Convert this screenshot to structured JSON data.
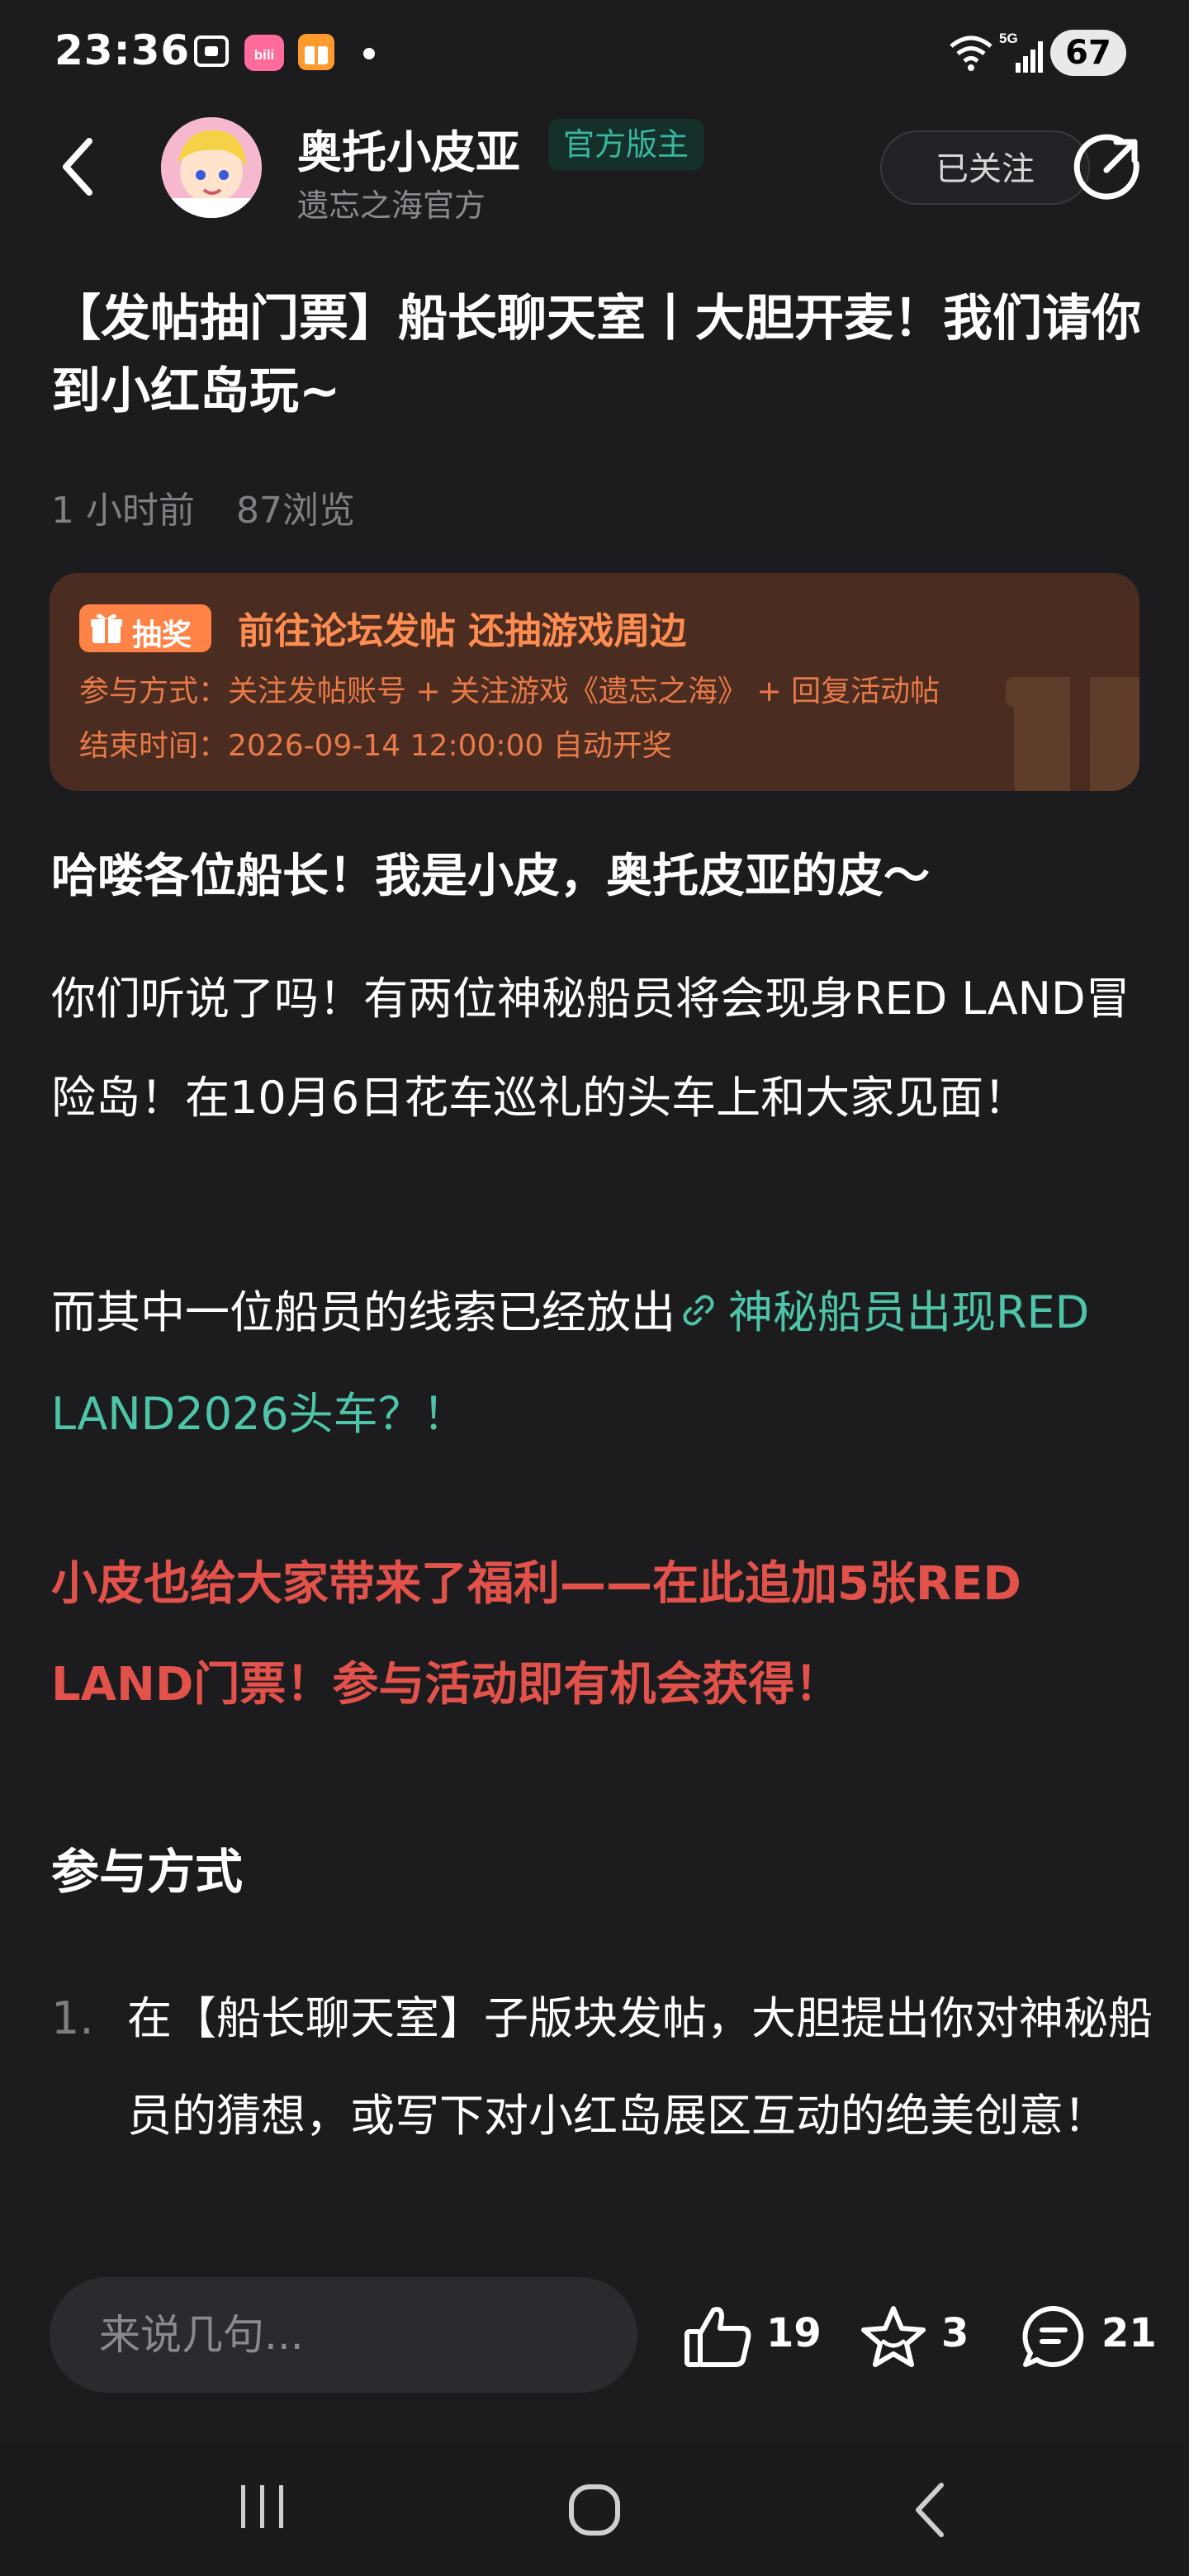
{
  "status_bar": {
    "time": "23:36",
    "network": "5G",
    "battery": "67"
  },
  "header": {
    "author": "奥托小皮亚",
    "badge": "官方版主",
    "subname": "遗忘之海官方",
    "follow_label": "已关注"
  },
  "post": {
    "title": "【发帖抽门票】船长聊天室丨大胆开麦！我们请你到小红岛玩~",
    "time_ago": "1 小时前",
    "views": "87浏览"
  },
  "lottery": {
    "tag": "抽奖",
    "headline": "前往论坛发帖 还抽游戏周边",
    "method": "参与方式：关注发帖账号 + 关注游戏《遗忘之海》 + 回复活动帖",
    "end_time": "结束时间：2026-09-14 12:00:00 自动开奖"
  },
  "content": {
    "greeting": "哈喽各位船长！我是小皮，奥托皮亚的皮～",
    "para1": "你们听说了吗！有两位神秘船员将会现身RED LAND冒险岛！在10月6日花车巡礼的头车上和大家见面！",
    "para2_prefix": "而其中一位船员的线索已经放出",
    "para2_link": "神秘船员出现RED LAND2026头车？！",
    "highlight": "小皮也给大家带来了福利——在此追加5张RED LAND门票！参与活动即有机会获得！",
    "section_title": "参与方式",
    "steps": [
      {
        "num": "1.",
        "text": "在【船长聊天室】子版块发帖，大胆提出你对神秘船员的猜想，或写下对小红岛展区互动的绝美创意！"
      }
    ]
  },
  "action_bar": {
    "input_placeholder": "来说几句...",
    "likes": "19",
    "favorites": "3",
    "comments": "21"
  },
  "colors": {
    "background": "#1c1c1f",
    "accent_green": "#4ec5a8",
    "lottery_orange": "#ff8247",
    "highlight_red": "#e2524b"
  }
}
